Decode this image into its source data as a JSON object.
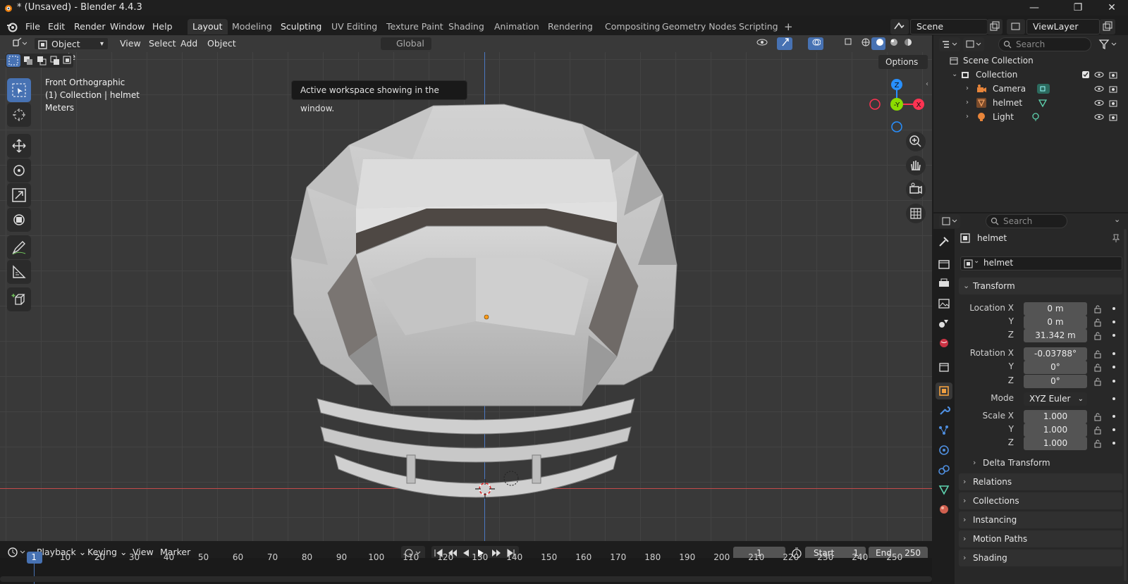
{
  "app_title": "* (Unsaved) - Blender 4.4.3",
  "window_controls": {
    "minimize": "—",
    "maximize": "❐",
    "close": "✕"
  },
  "menu": [
    "File",
    "Edit",
    "Render",
    "Window",
    "Help"
  ],
  "workspaces": [
    "Layout",
    "Modeling",
    "Sculpting",
    "UV Editing",
    "Texture Paint",
    "Shading",
    "Animation",
    "Rendering",
    "Compositing",
    "Geometry Nodes",
    "Scripting"
  ],
  "workspace_add": "+",
  "scene_name": "Scene",
  "view_layer": "ViewLayer",
  "viewport": {
    "mode": "Object Mode",
    "menus": [
      "View",
      "Select",
      "Add",
      "Object"
    ],
    "orientation": "Global",
    "options_label": "Options",
    "overlay_view": "Front Orthographic",
    "overlay_collection": "(1) Collection | helmet",
    "overlay_units": "Meters",
    "tooltip": "Active workspace showing in the window.",
    "gizmo": {
      "z": "Z",
      "y": "-Y",
      "x": "X"
    }
  },
  "outliner": {
    "search_placeholder": "Search",
    "root": "Scene Collection",
    "collection": "Collection",
    "items": [
      "Camera",
      "helmet",
      "Light"
    ]
  },
  "properties": {
    "search_placeholder": "Search",
    "object_name": "helmet",
    "object_field": "helmet",
    "transform_label": "Transform",
    "location_label": "Location X",
    "y_label": "Y",
    "z_label": "Z",
    "location": [
      "0 m",
      "0 m",
      "31.342 m"
    ],
    "rotation_label": "Rotation X",
    "rotation": [
      "-0.03788°",
      "0°",
      "0°"
    ],
    "mode_label": "Mode",
    "rotation_mode": "XYZ Euler",
    "scale_label": "Scale X",
    "scale": [
      "1.000",
      "1.000",
      "1.000"
    ],
    "delta_transform": "Delta Transform",
    "panels": [
      "Relations",
      "Collections",
      "Instancing",
      "Motion Paths",
      "Shading"
    ]
  },
  "timeline": {
    "menus": [
      "Playback",
      "Keying",
      "View",
      "Marker"
    ],
    "current_frame": "1",
    "start_label": "Start",
    "start": "1",
    "end_label": "End",
    "end": "250",
    "ruler": [
      "1",
      "10",
      "20",
      "30",
      "40",
      "50",
      "60",
      "70",
      "80",
      "90",
      "100",
      "110",
      "120",
      "130",
      "140",
      "150",
      "160",
      "170",
      "180",
      "190",
      "200",
      "210",
      "220",
      "230",
      "240",
      "250"
    ]
  },
  "colors": {
    "accent": "#4772b3",
    "x_axis": "#ff3352",
    "y_axis": "#8bdc00",
    "z_axis": "#2890ff",
    "viewport_bg": "#393939"
  }
}
